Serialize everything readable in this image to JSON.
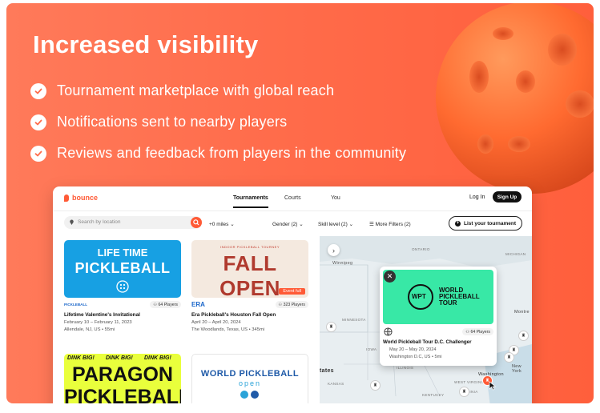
{
  "headline": "Increased visibility",
  "features": [
    "Tournament marketplace with global reach",
    "Notifications sent to nearby players",
    "Reviews and feedback from players in the community"
  ],
  "colors": {
    "background": "#ff6c4b",
    "brand": "#ff5a36",
    "ball": "#ff6a30"
  },
  "app": {
    "brand": "bounce",
    "tabs": [
      "Tournaments",
      "Courts",
      "You"
    ],
    "active_tab": "Tournaments",
    "login": "Log In",
    "signup": "Sign Up",
    "search_placeholder": "Search by location",
    "distance": "+0 miles",
    "gender": "Gender (2)",
    "skill": "Skill level (2)",
    "more_filters": "More Filters (2)",
    "list_button": "List your tournament",
    "cards": [
      {
        "banner_line1": "LIFE TIME",
        "banner_line2": "PICKLEBALL",
        "brand": "PICKLEBALL",
        "players": "64 Players",
        "name": "Lifetime Valentine's Invitational",
        "dates": "February 10 – February 11, 2023",
        "location": "Allendale, NJ, US • 55mi"
      },
      {
        "banner_top": "INDOOR PICKLEBALL TOURNEY",
        "banner_main": "FALL OPEN",
        "status": "Event full",
        "brand": "ERA",
        "players": "323 Players",
        "name": "Era Pickleball's Houston Fall Open",
        "dates": "April 20 – April 20, 2024",
        "location": "The Woodlands, Texas, US • 345mi"
      },
      {
        "banner_tag": "DINK BIG!",
        "banner_line1": "PARAGON",
        "banner_line2": "PICKLEBALL"
      },
      {
        "banner_line1": "WORLD PICKLEBALL",
        "banner_line2": "open"
      }
    ],
    "map": {
      "labels": [
        "ONTARIO",
        "Winnipeg",
        "MINNESOTA",
        "MICHIGAN",
        "IOWA",
        "ILLINOIS",
        "KANSAS",
        "KENTUCKY",
        "VIRGINIA",
        "WEST VIRGINIA",
        "Montre",
        "New York",
        "Washington",
        "tates"
      ],
      "popup": {
        "logo_short": "WPT",
        "logo_text": "WORLD PICKLEBALL TOUR",
        "players": "64 Players",
        "name": "World Pickleball Tour D.C. Challenger",
        "dates": "May 20 – May 20, 2024",
        "location": "Washington D.C, US • 5mi"
      }
    }
  }
}
